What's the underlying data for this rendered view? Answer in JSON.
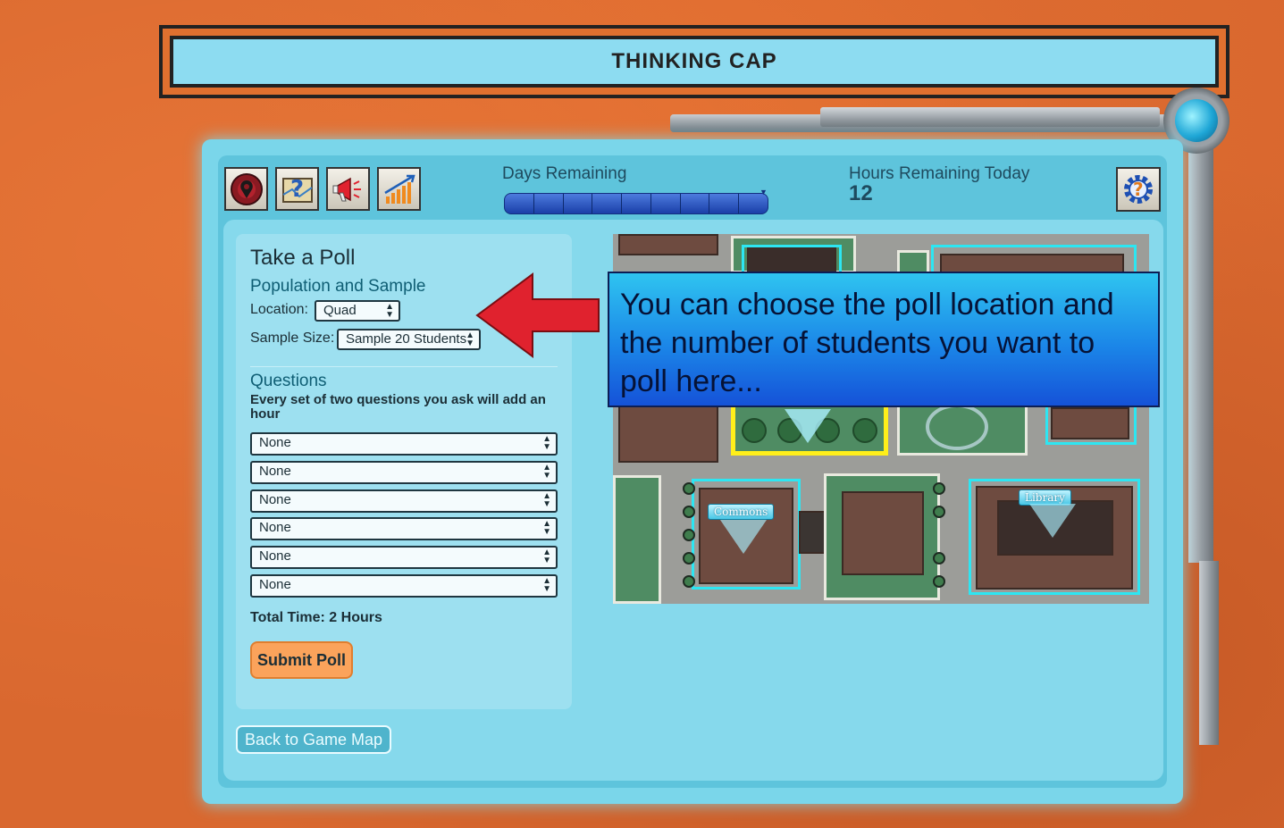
{
  "banner": {
    "title": "THINKING CAP"
  },
  "toolbar": {
    "buttons": [
      {
        "name": "map-pin-icon"
      },
      {
        "name": "help-map-icon"
      },
      {
        "name": "megaphone-icon"
      },
      {
        "name": "growth-chart-icon"
      }
    ],
    "settings_icon": "settings-gear-help-icon"
  },
  "status": {
    "days_label": "Days Remaining",
    "days_fill": 1.0,
    "hours_label": "Hours Remaining Today",
    "hours_value": "12"
  },
  "poll": {
    "title": "Take a Poll",
    "population_heading": "Population and Sample",
    "location_label": "Location:",
    "location_value": "Quad",
    "sample_label": "Sample Size:",
    "sample_value": "Sample 20 Students",
    "questions_heading": "Questions",
    "questions_note": "Every set of two questions you ask will add an hour",
    "questions": [
      "None",
      "None",
      "None",
      "None",
      "None",
      "None"
    ],
    "total_time": "Total Time: 2 Hours",
    "submit_label": "Submit Poll"
  },
  "nav": {
    "back_label": "Back to Game Map"
  },
  "map": {
    "labels": {
      "commons": "Commons",
      "library": "Library"
    }
  },
  "callout": {
    "text": "You can choose the poll location and the number of students you want to poll here..."
  },
  "colors": {
    "accent": "#fba35b",
    "frame": "#7ad6ea",
    "callout_arrow": "#e0222e"
  }
}
